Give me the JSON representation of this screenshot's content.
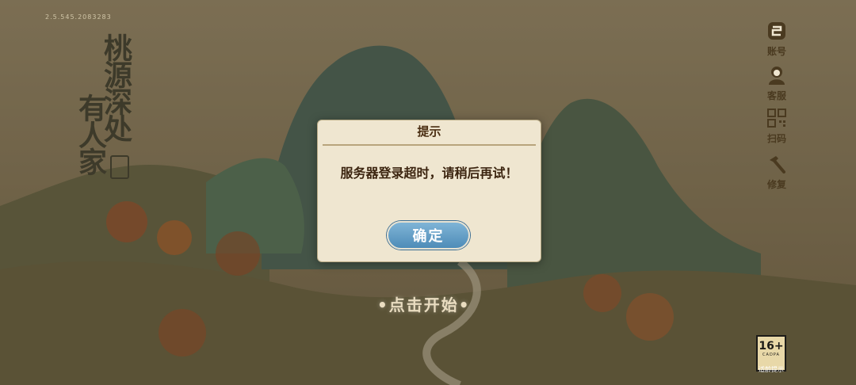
{
  "version": "2.5.545.2083283",
  "game_title": {
    "line1": "桃源深处",
    "line2": "有人家"
  },
  "sidebar": {
    "items": [
      {
        "label": "账号",
        "icon": "account-icon"
      },
      {
        "label": "客服",
        "icon": "customer-service-icon"
      },
      {
        "label": "扫码",
        "icon": "qr-scan-icon"
      },
      {
        "label": "修复",
        "icon": "repair-icon"
      }
    ]
  },
  "start_prompt": "•点击开始•",
  "dialog": {
    "title": "提示",
    "message": "服务器登录超时，请稍后再试！",
    "ok_label": "确定"
  },
  "age_rating": {
    "value": "16+",
    "badge": "CADPA",
    "label": "适龄提示"
  },
  "colors": {
    "dialog_bg": "#efe6d0",
    "button": "#5e9ac4",
    "title_ink": "#3d3a2a"
  }
}
